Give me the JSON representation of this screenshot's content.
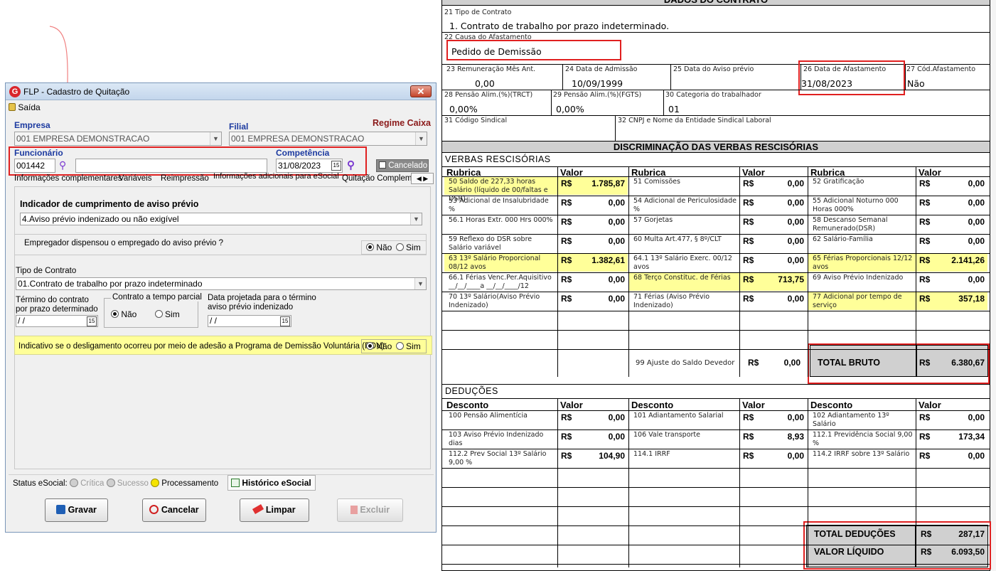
{
  "dialog": {
    "title": "FLP - Cadastro de Quitação",
    "close": "✕",
    "saida": "Saída",
    "empresa_label": "Empresa",
    "empresa_value": "001 EMPRESA DEMONSTRACAO",
    "filial_label": "Filial",
    "filial_value": "001 EMPRESA DEMONSTRACAO",
    "regime": "Regime Caixa",
    "funcionario_label": "Funcionário",
    "funcionario_value": "001442",
    "competencia_label": "Competência",
    "competencia_value": "31/08/2023",
    "cancelado": "Cancelado",
    "tabs": [
      "Informações complementares",
      "Variáveis",
      "Reimpressão",
      "Informações adicionais para eSocial",
      "Quitação Compleme"
    ],
    "aviso_title": "Indicador de cumprimento de aviso prévio",
    "aviso_value": "4.Aviso prévio indenizado ou não exigível",
    "dispensou_q": "Empregador dispensou o empregado do aviso prévio ?",
    "nao": "Não",
    "sim": "Sim",
    "tipo_contrato_label": "Tipo de Contrato",
    "tipo_contrato_value": "01.Contrato de trabalho por prazo indeterminado",
    "termino_label": "Término do contrato por prazo determinado",
    "termino_value": " /  /",
    "parcial_label": "Contrato a tempo parcial",
    "data_proj_label": "Data projetada para o término aviso prévio indenizado",
    "data_proj_value": " /  /",
    "pdv_q": "Indicativo se o desligamento ocorreu por meio de adesão a Programa de Demissão Voluntária (PDV)",
    "status_label": "Status eSocial:",
    "status_items": [
      "Crítica",
      "Sucesso",
      "Processamento"
    ],
    "historico": "Histórico eSocial",
    "buttons": {
      "gravar": "Gravar",
      "cancelar": "Cancelar",
      "limpar": "Limpar",
      "excluir": "Excluir"
    },
    "cal_icon": "15"
  },
  "form": {
    "header": "DADOS DO CONTRATO",
    "f21_label": "21 Tipo de Contrato",
    "f21_value": "1. Contrato de trabalho por prazo indeterminado.",
    "f22_label": "22 Causa  do Afastamento",
    "f22_value": "Pedido de Demissão",
    "f23_label": "23 Remuneração Mês Ant.",
    "f23_value": "0,00",
    "f24_label": "24 Data de Admissão",
    "f24_value": "10/09/1999",
    "f25_label": "25 Data do Aviso prévio",
    "f26_label": "26 Data  de Afastamento",
    "f26_value": "31/08/2023",
    "f27_label": "27 Cód.Afastamento",
    "f27_value": "Não",
    "f28_label": "28 Pensão Alim.(%)(TRCT)",
    "f28_value": "0,00%",
    "f29_label": "29 Pensão Alim.(%)(FGTS)",
    "f29_value": "0,00%",
    "f30_label": "30 Categoria do trabalhador",
    "f30_value": "01",
    "f31_label": "31 Código Sindical",
    "f32_label": "32 CNPJ  e Nome da Entidade Sindical Laboral",
    "discr_header": "DISCRIMINAÇÃO  DAS VERBAS RESCISÓRIAS",
    "verbas_title": "VERBAS RESCISÓRIAS",
    "rubrica": "Rubrica",
    "valor": "Valor",
    "rs": "R$",
    "verbas": [
      [
        "50 Saldo de 227,33 horas Salário  (líquido de 00/faltas e DSR)",
        "1.785,87",
        "51 Comissões",
        "0,00",
        "52 Gratificação",
        "0,00"
      ],
      [
        "53 Adicional de Insalubridade %",
        "0,00",
        "54 Adicional de Periculosidade %",
        "0,00",
        "55 Adicional Noturno  000 Horas 000%",
        "0,00"
      ],
      [
        "56.1 Horas Extr. 000 Hrs 000%",
        "0,00",
        "57 Gorjetas",
        "0,00",
        "58 Descanso Semanal Remunerado(DSR)",
        "0,00"
      ],
      [
        "59 Reflexo do DSR sobre Salário variável",
        "0,00",
        "60 Multa Art.477, § 8º/CLT",
        "0,00",
        "62 Salário-Família",
        "0,00"
      ],
      [
        "63 13º Salário Proporcional 08/12 avos",
        "1.382,61",
        "64.1 13º Salário Exerc.   00/12 avos",
        "0,00",
        "65 Férias Proporcionais  12/12 avos",
        "2.141,26"
      ],
      [
        "66.1 Férias Venc.Per.Aquisitivo __/__/____a __/__/____/12",
        "0,00",
        "68 Terço Constituc. de Férias",
        "713,75",
        "69 Aviso Prévio Indenizado",
        "0,00"
      ],
      [
        "70 13º Salário(Aviso Prévio Indenizado)",
        "0,00",
        "71 Férias (Aviso Prévio Indenizado)",
        "0,00",
        "77 Adicional por tempo de serviço",
        "357,18"
      ]
    ],
    "ajuste_label": "99  Ajuste do Saldo Devedor",
    "ajuste_value": "0,00",
    "total_bruto_label": "TOTAL BRUTO",
    "total_bruto_value": "6.380,67",
    "deducoes_title": "DEDUÇÕES",
    "desconto": "Desconto",
    "deducoes": [
      [
        "100 Pensão Alimentícia",
        "0,00",
        "101 Adiantamento Salarial",
        "0,00",
        "102 Adiantamento 13º Salário",
        "0,00"
      ],
      [
        "103 Aviso  Prévio Indenizado      dias",
        "0,00",
        "106 Vale transporte",
        "8,93",
        "112.1 Previdência Social 9,00 %",
        "173,34"
      ],
      [
        "112.2 Prev Social 13º Salário 9,00 %",
        "104,90",
        "114.1 IRRF",
        "0,00",
        "114.2 IRRF sobre 13º Salário",
        "0,00"
      ]
    ],
    "total_deducoes_label": "TOTAL  DEDUÇÕES",
    "total_deducoes_value": "287,17",
    "valor_liquido_label": "VALOR LÍQUIDO",
    "valor_liquido_value": "6.093,50"
  },
  "colors": {
    "red_highlight": "#e02020",
    "yellow_row": "#ffff99",
    "header_gray": "#d0d0d0",
    "dialog_bg": "#f0f0f0"
  }
}
